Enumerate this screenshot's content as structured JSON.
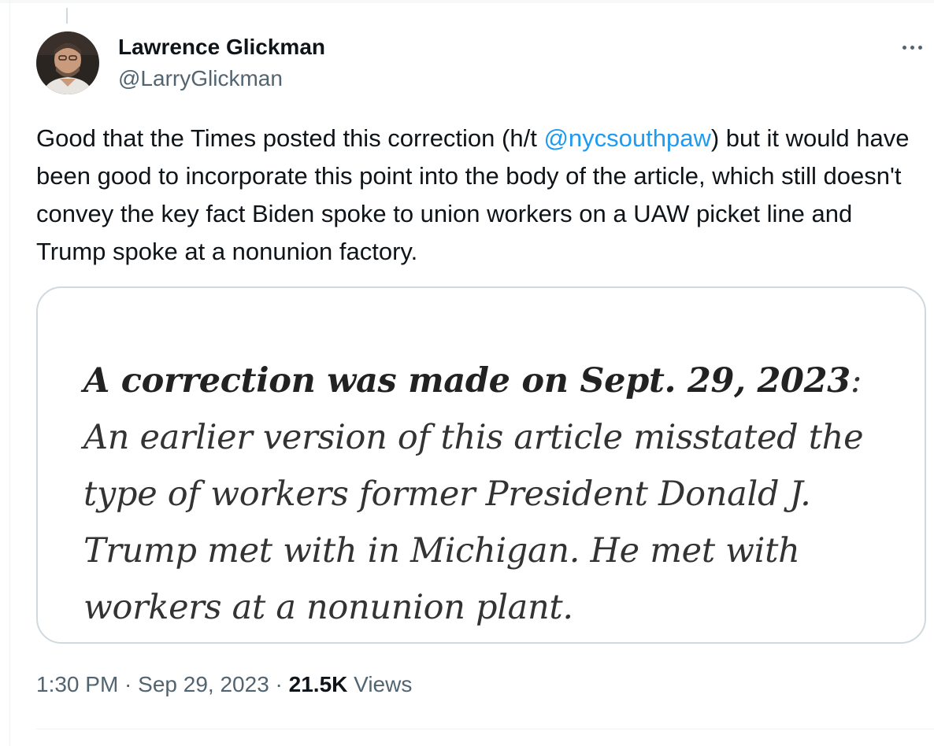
{
  "author": {
    "name": "Lawrence Glickman",
    "handle": "@LarryGlickman",
    "avatar_icon": "user-avatar-photo"
  },
  "more_icon": "ellipsis-icon",
  "tweet": {
    "text_before": "Good that the Times posted this correction (h/t ",
    "mention": "@nycsouthpaw",
    "text_after": ") but it would have been good to incorporate this point into the body of the article, which still doesn't convey the key fact Biden spoke to union workers on a UAW picket line and Trump spoke at a nonunion factory."
  },
  "media": {
    "correction_lead": "A correction was made on Sept. 29, 2023",
    "correction_body": ": An earlier version of this article misstated the type of workers former President Donald J. Trump met with in Michigan. He met with workers at a nonunion plant."
  },
  "meta": {
    "time": "1:30 PM",
    "separator": " · ",
    "date": "Sep 29, 2023",
    "views_count": "21.5K",
    "views_label": " Views"
  },
  "colors": {
    "accent": "#1d9bf0",
    "secondary_text": "#536471",
    "border": "#cfd9de"
  }
}
